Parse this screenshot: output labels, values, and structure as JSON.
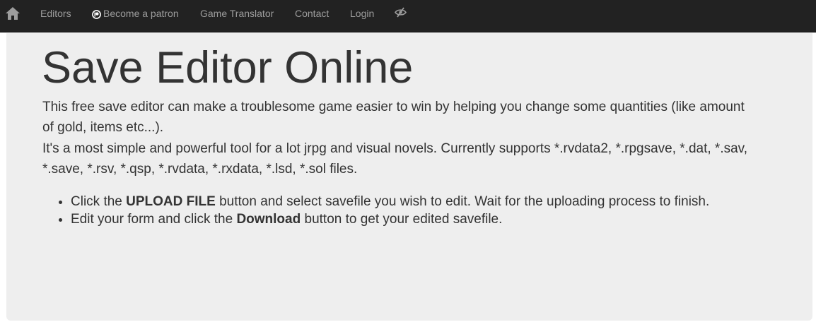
{
  "nav": {
    "home_icon": "home-icon",
    "items": [
      {
        "label": "Editors"
      },
      {
        "label": "Become a patron",
        "icon": "patreon-icon"
      },
      {
        "label": "Game Translator"
      },
      {
        "label": "Contact"
      },
      {
        "label": "Login"
      }
    ],
    "extra_icon": "eye-slash-icon"
  },
  "main": {
    "title": "Save Editor Online",
    "paragraph1": "This free save editor can make a troublesome game easier to win by helping you change some quantities (like amount of gold, items etc...).",
    "paragraph2": "It's a most simple and powerful tool for a lot jrpg and visual novels. Currently supports *.rvdata2, *.rpgsave, *.dat, *.sav, *.save, *.rsv, *.qsp, *.rvdata, *.rxdata, *.lsd, *.sol files.",
    "steps": [
      {
        "before": "Click the ",
        "bold": "UPLOAD FILE",
        "after": " button and select savefile you wish to edit. Wait for the uploading process to finish."
      },
      {
        "before": "Edit your form and click the ",
        "bold": "Download",
        "after": " button to get your edited savefile."
      }
    ]
  },
  "colors": {
    "navbar_bg": "#222222",
    "nav_text": "#9d9d9d",
    "jumbotron_bg": "#eeeeee",
    "text": "#333333"
  }
}
